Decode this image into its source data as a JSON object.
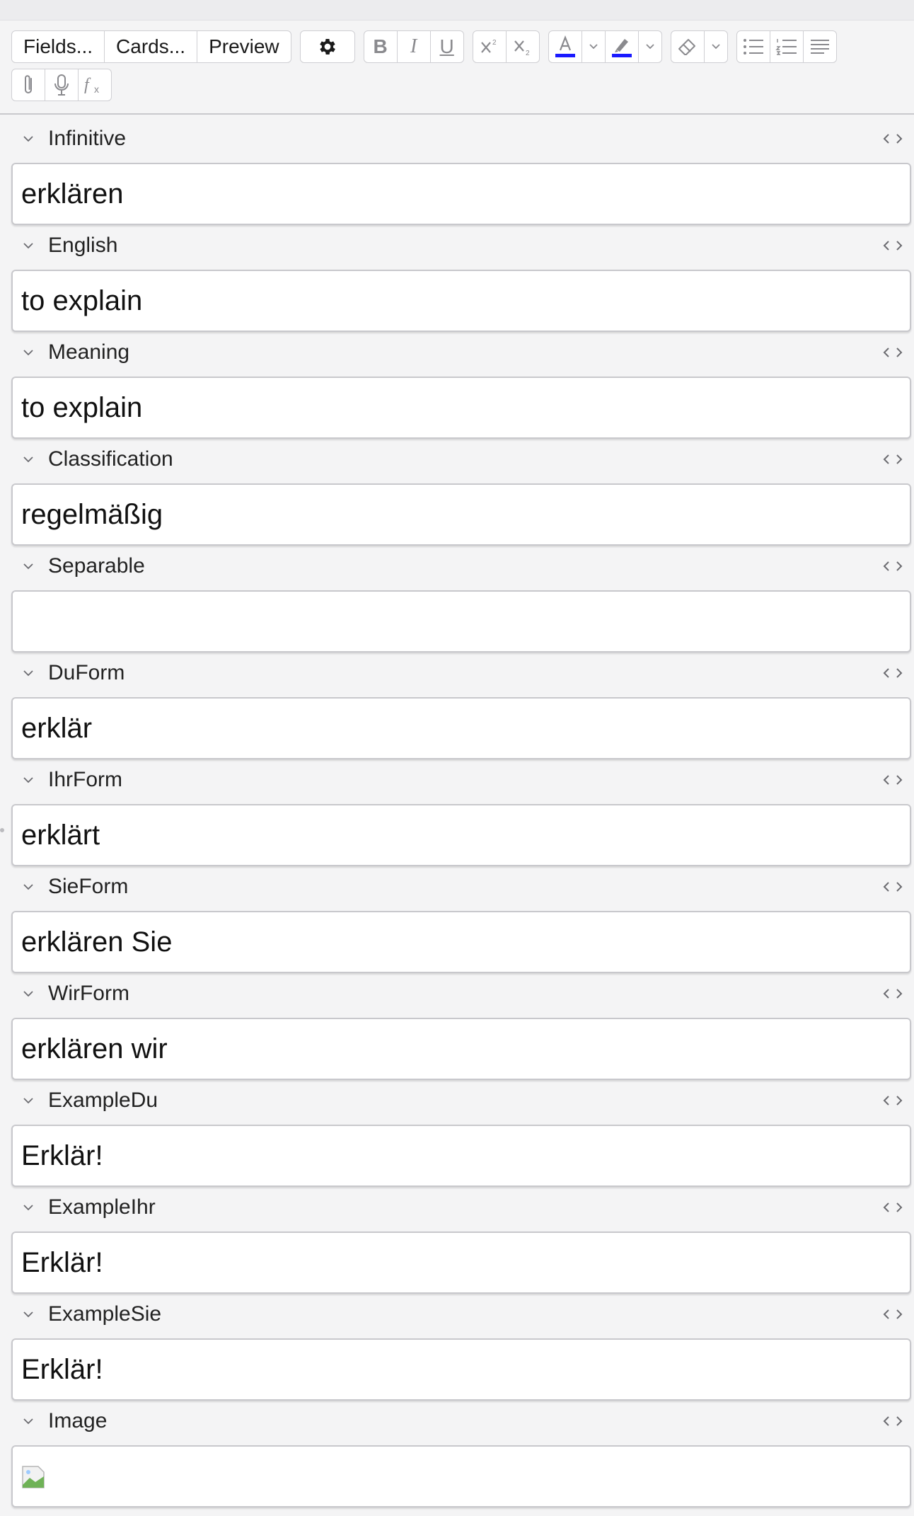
{
  "toolbar": {
    "fields_label": "Fields...",
    "cards_label": "Cards...",
    "preview_label": "Preview",
    "icons": {
      "settings": "gear-icon",
      "bold": "bold-icon",
      "italic": "italic-icon",
      "underline": "underline-icon",
      "superscript": "superscript-icon",
      "subscript": "subscript-icon",
      "text_color": "text-color-icon",
      "highlight": "highlight-icon",
      "eraser": "eraser-icon",
      "bullet_list": "bullet-list-icon",
      "numbered_list": "numbered-list-icon",
      "align": "align-icon",
      "attach": "paperclip-icon",
      "record": "microphone-icon",
      "math": "function-icon"
    },
    "bold_glyph": "B",
    "italic_glyph": "I",
    "underline_glyph": "U",
    "text_color": "#1a1aff",
    "highlight_color": "#1a1aff"
  },
  "fields": [
    {
      "label": "Infinitive",
      "value": "erklären"
    },
    {
      "label": "English",
      "value": "to explain"
    },
    {
      "label": "Meaning",
      "value": "to explain"
    },
    {
      "label": "Classification",
      "value": "regelmäßig"
    },
    {
      "label": "Separable",
      "value": ""
    },
    {
      "label": "DuForm",
      "value": "erklär"
    },
    {
      "label": "IhrForm",
      "value": "erklärt"
    },
    {
      "label": "SieForm",
      "value": "erklären Sie"
    },
    {
      "label": "WirForm",
      "value": "erklären wir"
    },
    {
      "label": "ExampleDu",
      "value": "Erklär!"
    },
    {
      "label": "ExampleIhr",
      "value": "Erklär!"
    },
    {
      "label": "ExampleSie",
      "value": "Erklär!"
    },
    {
      "label": "Image",
      "value": ""
    }
  ]
}
